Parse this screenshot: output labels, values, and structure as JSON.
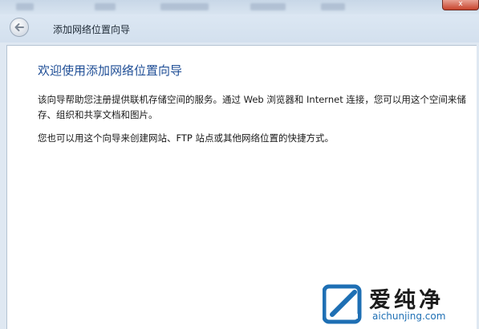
{
  "window": {
    "close_label": "x"
  },
  "nav": {
    "title": "添加网络位置向导"
  },
  "main": {
    "heading": "欢迎使用添加网络位置向导",
    "paragraph1": "该向导帮助您注册提供联机存储空间的服务。通过 Web 浏览器和 Internet 连接，您可以用这个空间来储存、组织和共享文档和图片。",
    "paragraph2": "您也可以用这个向导来创建网站、FTP 站点或其他网络位置的快捷方式。"
  },
  "watermark": {
    "name": "爱纯净",
    "url": "aichunjing.com"
  },
  "colors": {
    "heading": "#1f4e96",
    "watermark_accent": "#1e6fb4"
  }
}
